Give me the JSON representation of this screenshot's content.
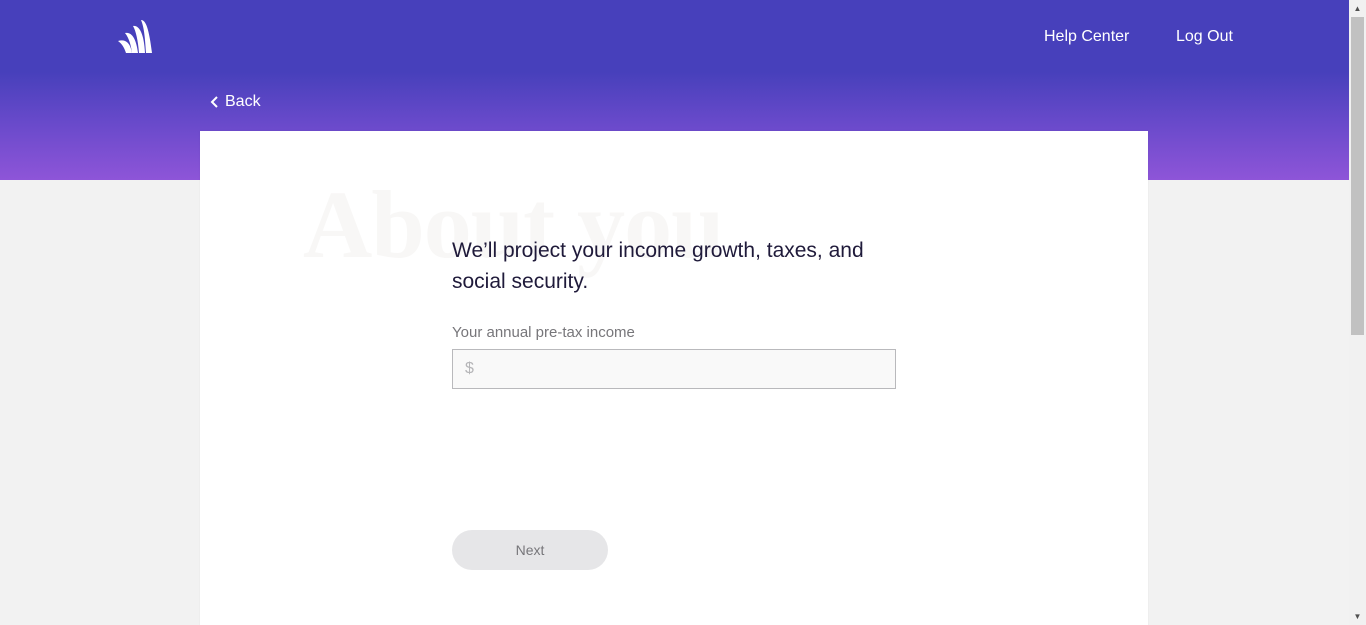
{
  "header": {
    "logo": "wealthfront-logo",
    "nav": {
      "help_center": "Help Center",
      "log_out": "Log Out"
    },
    "back_label": "Back"
  },
  "card": {
    "watermark": "About you",
    "question": "We’ll project your income growth, taxes, and social security.",
    "income_field": {
      "label": "Your annual pre-tax income",
      "currency_symbol": "$",
      "value": "",
      "placeholder": ""
    },
    "next_label": "Next"
  },
  "colors": {
    "header_top": "#4740bb",
    "header_bottom": "#8e55d8",
    "background": "#f2f2f2",
    "card": "#ffffff",
    "question_text": "#1f1a3a",
    "button_disabled_bg": "#e6e6e8"
  }
}
